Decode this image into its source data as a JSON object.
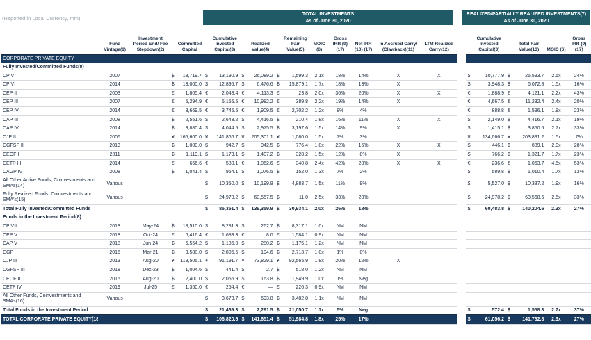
{
  "note": "(Reported in Local Currency, mm)",
  "band_total": {
    "line1": "TOTAL INVESTMENTS",
    "line2": "As of June 30, 2020"
  },
  "band_realized": {
    "line1": "REALIZED/PARTIALLY REALIZED INVESTMENTS(7)",
    "line2": "As of June 30, 2020"
  },
  "headers": [
    "",
    "Fund Vintage(1)",
    "Investment Period End/ Fee Stepdown(2)",
    "",
    "Committed Capital",
    "",
    "Cumulative Invested Capital(3)",
    "",
    "Realized Value(4)",
    "",
    "Remaining Fair Value(5)",
    "MOIC (6)",
    "Gross IRR (9)(17)",
    "Net IRR (10) (17)",
    "In Accrued Carry/ (Clawback)(11)",
    "LTM Realized Carry(12)",
    "",
    "",
    "Cumulative Invested Capital(3)",
    "",
    "Total Fair Value(13)",
    "MOIC (6)",
    "Gross IRR (9)(17)"
  ],
  "sections": [
    {
      "title": "CORPORATE PRIVATE EQUITY",
      "type": "sec"
    },
    {
      "title": "Fully Invested/Committed Funds(8)",
      "type": "sub"
    },
    {
      "type": "row",
      "c": [
        "CP V",
        "2007",
        "",
        "$",
        "13,719.7",
        "$",
        "13,190.9",
        "$",
        "26,089.2",
        "$",
        "1,599.3",
        "2.1x",
        "18%",
        "14%",
        "X",
        "X",
        "",
        "$",
        "10,777.9",
        "$",
        "26,593.7",
        "2.5x",
        "24%"
      ]
    },
    {
      "type": "row",
      "c": [
        "CP VI",
        "2014",
        "",
        "$",
        "13,000.0",
        "$",
        "12,895.7",
        "$",
        "6,476.6",
        "$",
        "15,879.1",
        "1.7x",
        "18%",
        "13%",
        "X",
        "",
        "",
        "$",
        "3,948.3",
        "$",
        "6,072.8",
        "1.5x",
        "16%"
      ]
    },
    {
      "type": "row",
      "c": [
        "CEP II",
        "2003",
        "",
        "€",
        "1,805.4",
        "€",
        "2,048.4",
        "€",
        "4,113.3",
        "€",
        "23.8",
        "2.0x",
        "36%",
        "20%",
        "X",
        "X",
        "",
        "€",
        "1,888.9",
        "€",
        "4,121.1",
        "2.2x",
        "43%"
      ]
    },
    {
      "type": "row",
      "c": [
        "CEP III",
        "2007",
        "",
        "€",
        "5,294.9",
        "€",
        "5,155.5",
        "€",
        "10,982.2",
        "€",
        "389.8",
        "2.2x",
        "19%",
        "14%",
        "X",
        "",
        "",
        "€",
        "4,667.5",
        "€",
        "11,232.4",
        "2.4x",
        "20%"
      ]
    },
    {
      "type": "row",
      "c": [
        "CEP IV",
        "2014",
        "",
        "€",
        "3,669.5",
        "€",
        "3,745.5",
        "€",
        "1,909.5",
        "€",
        "2,702.2",
        "1.2x",
        "8%",
        "4%",
        "",
        "",
        "",
        "€",
        "888.8",
        "€",
        "1,596.1",
        "1.8x",
        "23%"
      ]
    },
    {
      "type": "row",
      "c": [
        "CAP III",
        "2008",
        "",
        "$",
        "2,551.6",
        "$",
        "2,643.2",
        "$",
        "4,416.5",
        "$",
        "210.4",
        "1.8x",
        "16%",
        "11%",
        "X",
        "X",
        "",
        "$",
        "2,149.0",
        "$",
        "4,416.7",
        "2.1x",
        "19%"
      ]
    },
    {
      "type": "row",
      "c": [
        "CAP IV",
        "2014",
        "",
        "$",
        "3,880.4",
        "$",
        "4,044.5",
        "$",
        "2,975.5",
        "$",
        "3,197.6",
        "1.5x",
        "14%",
        "9%",
        "X",
        "",
        "",
        "$",
        "1,415.1",
        "$",
        "3,850.6",
        "2.7x",
        "33%"
      ]
    },
    {
      "type": "row",
      "c": [
        "CJP II",
        "2006",
        "",
        "¥",
        "165,600.0",
        "¥",
        "141,866.7",
        "¥",
        "205,301.1",
        "¥",
        "1,080.0",
        "1.5x",
        "7%",
        "3%",
        "",
        "",
        "",
        "¥",
        "134,666.7",
        "¥",
        "203,831.2",
        "1.5x",
        "7%"
      ]
    },
    {
      "type": "row",
      "c": [
        "CGFSP II",
        "2013",
        "",
        "$",
        "1,000.0",
        "$",
        "942.7",
        "$",
        "942.5",
        "$",
        "776.4",
        "1.8x",
        "22%",
        "15%",
        "X",
        "X",
        "",
        "$",
        "446.1",
        "$",
        "889.1",
        "2.0x",
        "28%"
      ]
    },
    {
      "type": "row",
      "c": [
        "CEOF I",
        "2011",
        "",
        "$",
        "1,119.1",
        "$",
        "1,173.1",
        "$",
        "1,407.2",
        "$",
        "328.2",
        "1.5x",
        "12%",
        "8%",
        "X",
        "",
        "",
        "$",
        "766.2",
        "$",
        "1,321.7",
        "1.7x",
        "23%"
      ]
    },
    {
      "type": "row",
      "c": [
        "CETP III",
        "2014",
        "",
        "€",
        "656.6",
        "€",
        "580.1",
        "€",
        "1,062.6",
        "€",
        "340.8",
        "2.4x",
        "42%",
        "28%",
        "X",
        "X",
        "",
        "€",
        "236.6",
        "€",
        "1,063.7",
        "4.5x",
        "53%"
      ]
    },
    {
      "type": "row",
      "c": [
        "CAGP IV",
        "2008",
        "",
        "$",
        "1,041.4",
        "$",
        "954.1",
        "$",
        "1,076.5",
        "$",
        "152.0",
        "1.3x",
        "7%",
        "2%",
        "",
        "",
        "",
        "$",
        "589.8",
        "$",
        "1,010.4",
        "1.7x",
        "13%"
      ]
    },
    {
      "type": "wrap",
      "c": [
        "All Other Active Funds, Coinvestments and SMAs(14)",
        "Various",
        "",
        "",
        "",
        "$",
        "10,350.0",
        "$",
        "10,199.9",
        "$",
        "4,883.7",
        "1.5x",
        "11%",
        "9%",
        "",
        "",
        "",
        "$",
        "5,527.0",
        "$",
        "10,337.2",
        "1.9x",
        "16%"
      ]
    },
    {
      "type": "wrap",
      "c": [
        "Fully Realized Funds, Coinvestments and SMA's(15)",
        "Various",
        "",
        "",
        "",
        "$",
        "24,978.2",
        "$",
        "63,557.5",
        "$",
        "11.0",
        "2.5x",
        "33%",
        "28%",
        "",
        "",
        "",
        "$",
        "24,978.2",
        "$",
        "63,568.6",
        "2.5x",
        "33%"
      ]
    },
    {
      "type": "tot",
      "c": [
        "Total Fully Invested/Committed Funds",
        "",
        "",
        "",
        "",
        "$",
        "85,351.4",
        "$",
        "139,359.9",
        "$",
        "30,934.1",
        "2.0x",
        "26%",
        "18%",
        "",
        "",
        "",
        "$",
        "60,483.8",
        "$",
        "140,204.6",
        "2.3x",
        "27%"
      ]
    },
    {
      "title": "Funds in the Investment Period(8)",
      "type": "sub"
    },
    {
      "type": "row",
      "c": [
        "CP VII",
        "2018",
        "May-24",
        "$",
        "18,510.0",
        "$",
        "8,281.3",
        "$",
        "262.7",
        "$",
        "8,317.1",
        "1.0x",
        "NM",
        "NM",
        "",
        "",
        "",
        "",
        "",
        "",
        "",
        "",
        ""
      ]
    },
    {
      "type": "row",
      "c": [
        "CEP V",
        "2018",
        "Oct-24",
        "€",
        "6,416.4",
        "€",
        "1,683.3",
        "€",
        "8.0",
        "€",
        "1,584.1",
        "0.9x",
        "NM",
        "NM",
        "",
        "",
        "",
        "",
        "",
        "",
        "",
        "",
        ""
      ]
    },
    {
      "type": "row",
      "c": [
        "CAP V",
        "2018",
        "Jun-24",
        "$",
        "6,554.2",
        "$",
        "1,186.0",
        "$",
        "280.2",
        "$",
        "1,175.1",
        "1.2x",
        "NM",
        "NM",
        "",
        "",
        "",
        "",
        "",
        "",
        "",
        "",
        ""
      ]
    },
    {
      "type": "row",
      "c": [
        "CGP",
        "2015",
        "Mar-21",
        "$",
        "3,588.0",
        "$",
        "2,806.5",
        "$",
        "194.6",
        "$",
        "2,713.7",
        "1.0x",
        "1%",
        "0%",
        "",
        "",
        "",
        "",
        "",
        "",
        "",
        "",
        ""
      ]
    },
    {
      "type": "row",
      "c": [
        "CJP III",
        "2013",
        "Aug-20",
        "¥",
        "119,505.1",
        "¥",
        "91,191.7",
        "¥",
        "73,829.1",
        "¥",
        "92,565.9",
        "1.8x",
        "20%",
        "12%",
        "X",
        "",
        "",
        "",
        "",
        "",
        "",
        "",
        ""
      ]
    },
    {
      "type": "row",
      "c": [
        "CGFSP III",
        "2018",
        "Dec-23",
        "$",
        "1,004.6",
        "$",
        "441.4",
        "$",
        "2.7",
        "$",
        "518.0",
        "1.2x",
        "NM",
        "NM",
        "",
        "",
        "",
        "",
        "",
        "",
        "",
        "",
        ""
      ]
    },
    {
      "type": "row",
      "c": [
        "CEOF II",
        "2015",
        "Aug-20",
        "$",
        "2,400.0",
        "$",
        "2,055.9",
        "$",
        "163.8",
        "$",
        "1,949.9",
        "1.0x",
        "1%",
        "Neg",
        "",
        "",
        "",
        "",
        "",
        "",
        "",
        "",
        ""
      ]
    },
    {
      "type": "row",
      "c": [
        "CETP IV",
        "2019",
        "Jul-25",
        "€",
        "1,350.0",
        "€",
        "254.4",
        "€",
        "—",
        "€",
        "226.3",
        "0.9x",
        "NM",
        "NM",
        "",
        "",
        "",
        "",
        "",
        "",
        "",
        "",
        ""
      ]
    },
    {
      "type": "wrap",
      "c": [
        "All Other Funds, Coinvestments and SMAs(16)",
        "Various",
        "",
        "",
        "",
        "$",
        "3,673.7",
        "$",
        "693.8",
        "$",
        "3,482.8",
        "1.1x",
        "NM",
        "NM",
        "",
        "",
        "",
        "",
        "",
        "",
        "",
        "",
        ""
      ]
    },
    {
      "type": "tot",
      "c": [
        "Total Funds in the Investment Period",
        "",
        "",
        "",
        "",
        "$",
        "21,469.3",
        "$",
        "2,291.5",
        "$",
        "21,050.7",
        "1.1x",
        "5%",
        "Neg",
        "",
        "",
        "",
        "$",
        "572.4",
        "$",
        "1,558.3",
        "2.7x",
        "37%"
      ]
    },
    {
      "type": "grand",
      "c": [
        "TOTAL CORPORATE PRIVATE EQUITY(18)",
        "",
        "",
        "",
        "",
        "$",
        "106,820.6",
        "$",
        "141,651.4",
        "$",
        "51,984.8",
        "1.8x",
        "25%",
        "17%",
        "",
        "",
        "",
        "$",
        "61,056.2",
        "$",
        "141,762.8",
        "2.3x",
        "27%"
      ]
    }
  ]
}
